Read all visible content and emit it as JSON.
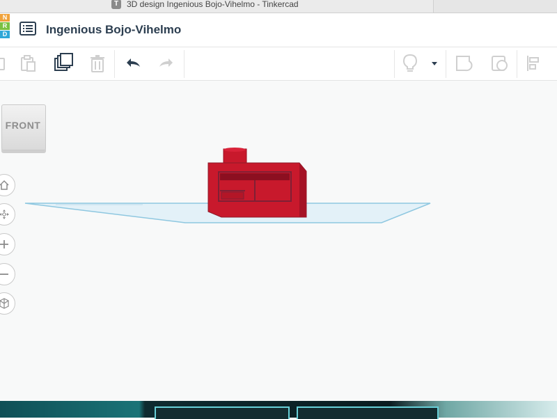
{
  "browser": {
    "tab_title": "3D design Ingenious Bojo-Vihelmo - Tinkercad",
    "favicon_letter": "T"
  },
  "app": {
    "logo_letters": [
      "N",
      "R",
      "D"
    ],
    "logo_colors": [
      "#f0a23b",
      "#7ac142",
      "#2fa7d8"
    ],
    "menu_icon": "list-menu-icon",
    "design_title": "Ingenious Bojo-Vihelmo"
  },
  "toolbar": {
    "buttons": [
      "copy-icon",
      "paste-icon",
      "duplicate-icon",
      "delete-icon",
      "undo-icon",
      "redo-icon",
      "lightbulb-icon",
      "chevron-down-icon",
      "shape-solid-icon",
      "shape-hole-icon",
      "align-icon"
    ]
  },
  "viewcube": {
    "face_label": "FRONT"
  },
  "navigation": {
    "buttons": [
      "home-icon",
      "fit-view-icon",
      "zoom-in-icon",
      "zoom-out-icon",
      "perspective-icon"
    ]
  },
  "scene": {
    "object_color": "#c8192c",
    "workplane_color": "#d6ecf5"
  }
}
